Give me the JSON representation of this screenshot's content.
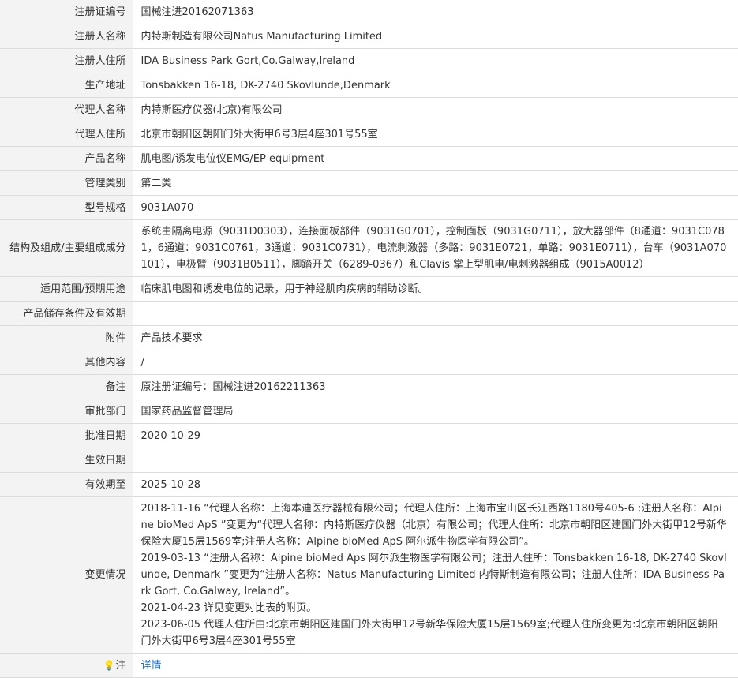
{
  "rows": [
    {
      "label": "注册证编号",
      "value": "国械注进20162071363"
    },
    {
      "label": "注册人名称",
      "value": "内特斯制造有限公司Natus Manufacturing Limited"
    },
    {
      "label": "注册人住所",
      "value": "IDA Business Park Gort,Co.Galway,Ireland"
    },
    {
      "label": "生产地址",
      "value": "Tonsbakken 16-18, DK-2740 Skovlunde,Denmark"
    },
    {
      "label": "代理人名称",
      "value": "内特斯医疗仪器(北京)有限公司"
    },
    {
      "label": "代理人住所",
      "value": "北京市朝阳区朝阳门外大街甲6号3层4座301号55室"
    },
    {
      "label": "产品名称",
      "value": "肌电图/诱发电位仪EMG/EP equipment"
    },
    {
      "label": "管理类别",
      "value": "第二类"
    },
    {
      "label": "型号规格",
      "value": "9031A070"
    },
    {
      "label": "结构及组成/主要组成成分",
      "value": "系统由隔离电源（9031D0303），连接面板部件（9031G0701），控制面板（9031G0711），放大器部件（8通道：9031C0781，6通道：9031C0761，3通道：9031C0731），电流刺激器（多路：9031E0721，单路：9031E0711），台车（9031A070101），电极臂（9031B0511），脚踏开关（6289-0367）和Clavis 掌上型肌电/电刺激器组成（9015A0012）"
    },
    {
      "label": "适用范围/预期用途",
      "value": "临床肌电图和诱发电位的记录，用于神经肌肉疾病的辅助诊断。"
    },
    {
      "label": "产品储存条件及有效期",
      "value": ""
    },
    {
      "label": "附件",
      "value": "产品技术要求"
    },
    {
      "label": "其他内容",
      "value": "/"
    },
    {
      "label": "备注",
      "value": "原注册证编号：国械注进20162211363"
    },
    {
      "label": "审批部门",
      "value": "国家药品监督管理局"
    },
    {
      "label": "批准日期",
      "value": "2020-10-29"
    },
    {
      "label": "生效日期",
      "value": ""
    },
    {
      "label": "有效期至",
      "value": "2025-10-28"
    }
  ],
  "changes": {
    "label": "变更情况",
    "entries": [
      "2018-11-16 “代理人名称：上海本迪医疗器械有限公司；代理人住所：上海市宝山区长江西路1180号405-6 ;注册人名称：Alpine bioMed ApS ”变更为“代理人名称：内特斯医疗仪器（北京）有限公司；代理人住所：北京市朝阳区建国门外大街甲12号新华保险大厦15层1569室;注册人名称：Alpine bioMed ApS 阿尔派生物医学有限公司”。",
      "2019-03-13 “注册人名称：Alpine bioMed Aps 阿尔派生物医学有限公司；注册人住所：Tonsbakken 16-18, DK-2740 Skovlunde, Denmark ”变更为“注册人名称：Natus Manufacturing Limited 内特斯制造有限公司；注册人住所：IDA Business Park Gort, Co.Galway, Ireland”。",
      "2021-04-23 详见变更对比表的附页。",
      "2023-06-05 代理人住所由:北京市朝阳区建国门外大街甲12号新华保险大厦15层1569室;代理人住所变更为:北京市朝阳区朝阳门外大街甲6号3层4座301号55室"
    ]
  },
  "note": {
    "label": "注",
    "icon": "lightbulb-icon",
    "link_text": "详情",
    "link_color": "#1a6fc9"
  }
}
